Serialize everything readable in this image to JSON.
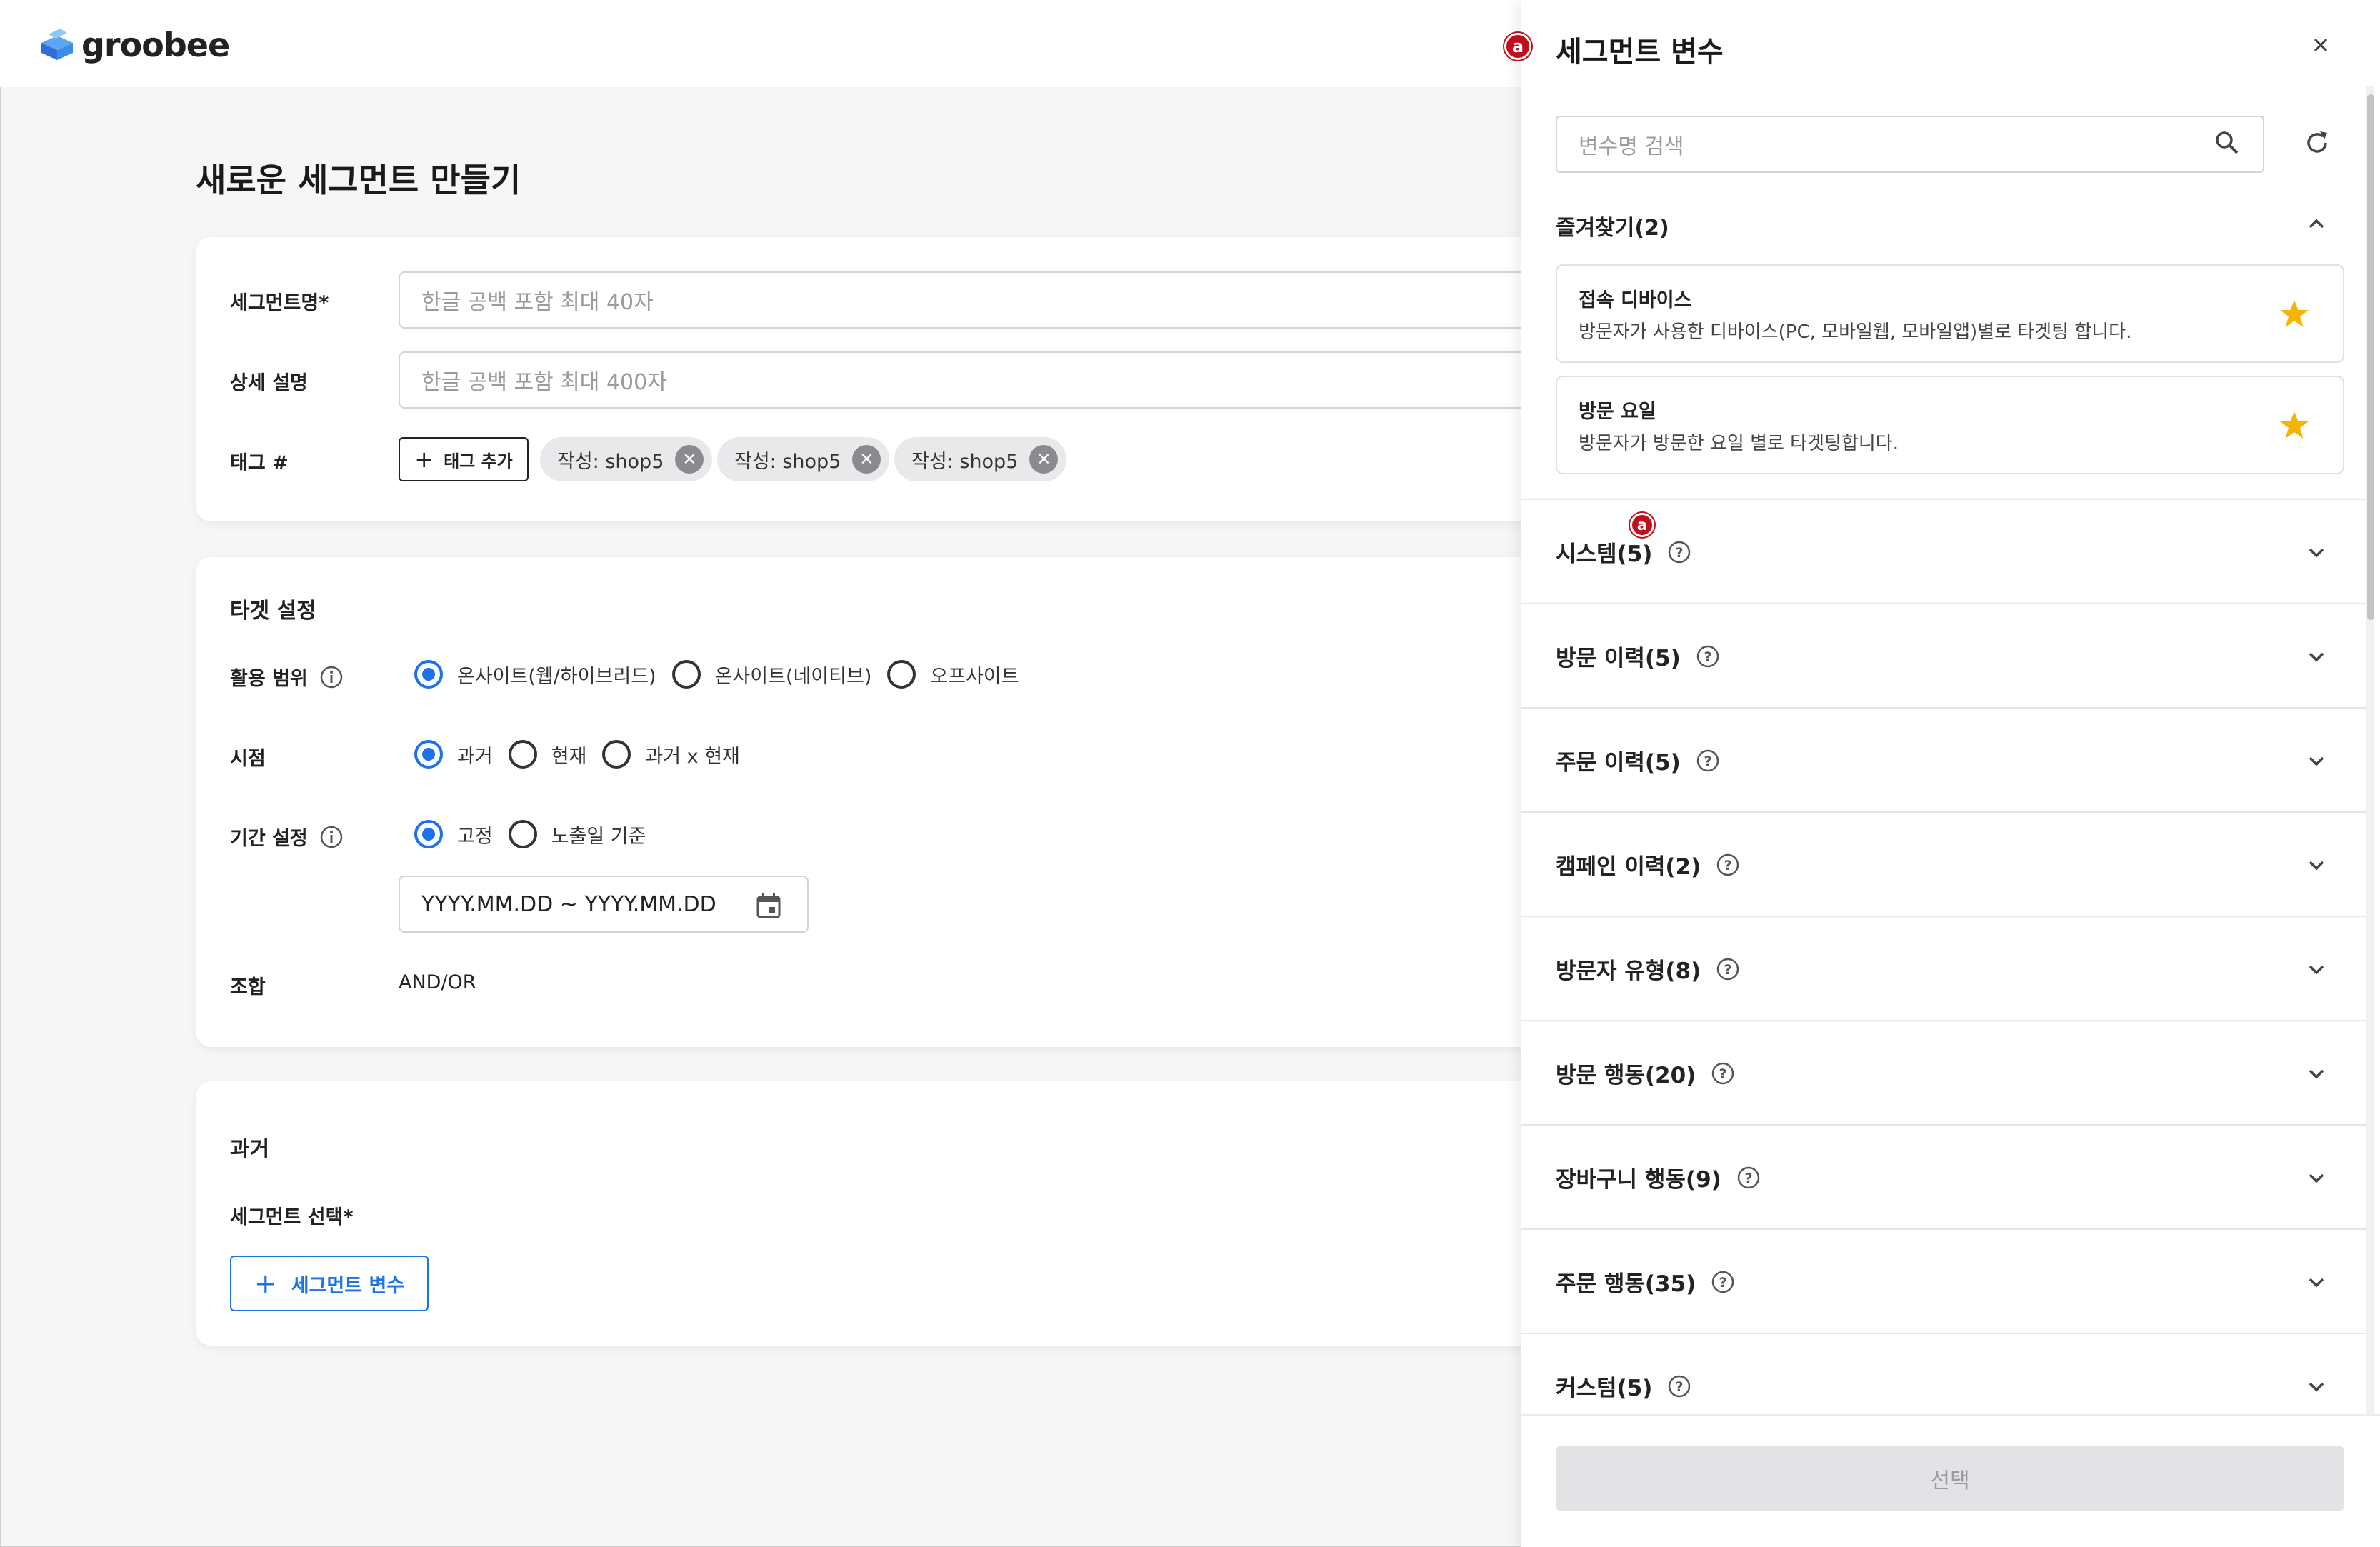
{
  "app": {
    "logo_text": "groobee"
  },
  "page": {
    "title": "새로운 세그먼트 만들기"
  },
  "basic": {
    "name_label": "세그먼트명*",
    "name_placeholder": "한글 공백 포함 최대 40자",
    "desc_label": "상세 설명",
    "desc_placeholder": "한글 공백 포함 최대 400자",
    "tag_label": "태그 #",
    "tag_add_label": "태그 추가",
    "tags": [
      "작성: shop5",
      "작성: shop5",
      "작성: shop5"
    ]
  },
  "target": {
    "title": "타겟 설정",
    "scope_label": "활용 범위",
    "scope_options": [
      "온사이트(웹/하이브리드)",
      "온사이트(네이티브)",
      "오프사이트"
    ],
    "scope_selected": "온사이트(웹/하이브리드)",
    "time_label": "시점",
    "time_options": [
      "과거",
      "현재",
      "과거 x 현재"
    ],
    "time_selected": "과거",
    "period_label": "기간 설정",
    "period_options": [
      "고정",
      "노출일 기준"
    ],
    "period_selected": "고정",
    "date_placeholder": "YYYY.MM.DD ~ YYYY.MM.DD",
    "combo_label": "조합",
    "combo_value": "AND/OR"
  },
  "past": {
    "title": "과거",
    "segment_label": "세그먼트 선택*",
    "segment_button": "세그먼트 변수"
  },
  "panel": {
    "marker": "a",
    "title": "세그먼트 변수",
    "search_placeholder": "변수명 검색",
    "favorites_title": "즐겨찾기(2)",
    "favorites": [
      {
        "name": "접속 디바이스",
        "desc": "방문자가 사용한 디바이스(PC, 모바일웹, 모바일앱)별로 타겟팅 합니다."
      },
      {
        "name": "방문 요일",
        "desc": "방문자가 방문한 요일 별로 타겟팅합니다."
      }
    ],
    "categories": [
      "시스템(5)",
      "방문 이력(5)",
      "주문 이력(5)",
      "캠페인 이력(2)",
      "방문자 유형(8)",
      "방문 행동(20)",
      "장바구니 행동(9)",
      "주문 행동(35)",
      "커스텀(5)"
    ],
    "select_label": "선택"
  },
  "colors": {
    "accent": "#1a73e8",
    "marker": "#c20e1a",
    "star": "#f5b400"
  },
  "icons": [
    "logo-icon",
    "info-icon",
    "calendar-icon",
    "close-icon",
    "search-icon",
    "refresh-icon",
    "chevron-up-icon",
    "chevron-down-icon",
    "star-icon",
    "help-icon",
    "plus-icon"
  ]
}
